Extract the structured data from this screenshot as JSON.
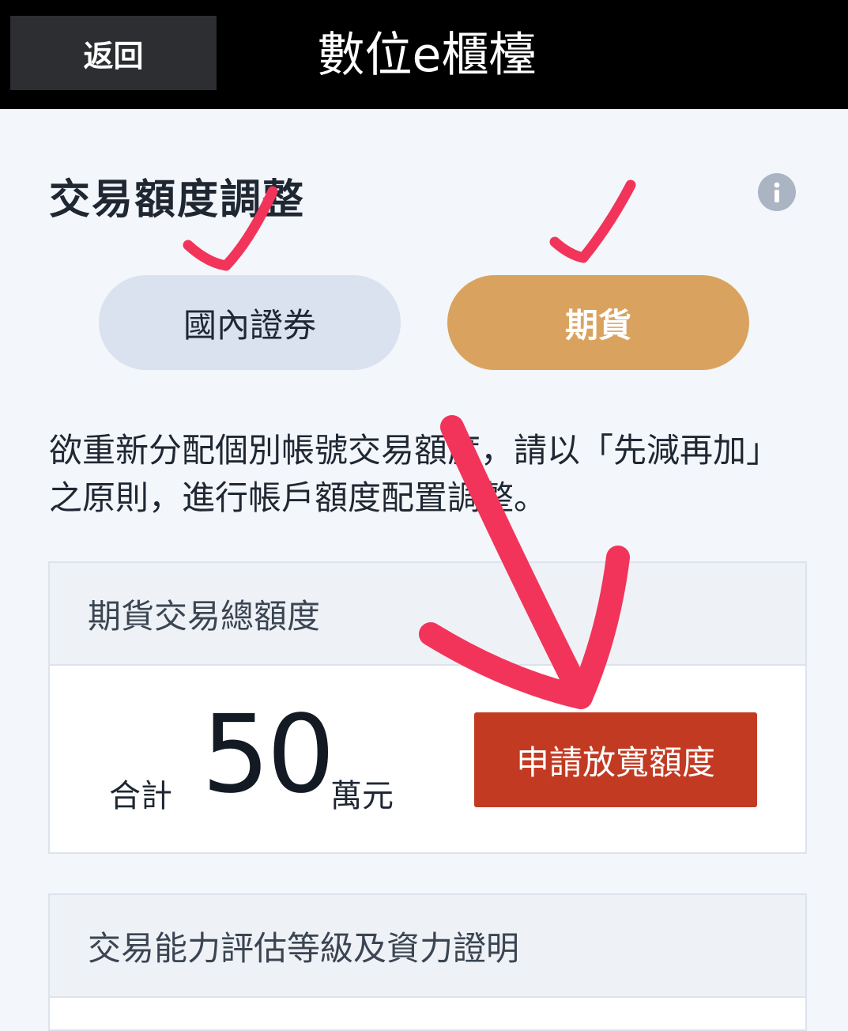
{
  "header": {
    "back_label": "返回",
    "title": "數位e櫃檯"
  },
  "page": {
    "title": "交易額度調整",
    "info_icon": "info-icon"
  },
  "tabs": [
    {
      "label": "國內證券",
      "active": false
    },
    {
      "label": "期貨",
      "active": true
    }
  ],
  "description": "欲重新分配個別帳號交易額度，請以「先減再加」之原則，進行帳戶額度配置調整。",
  "quota_card": {
    "header": "期貨交易總額度",
    "total_label": "合計",
    "total_value": "50",
    "total_unit": "萬元",
    "apply_label": "申請放寬額度"
  },
  "assessment_card": {
    "header": "交易能力評估等級及資力證明"
  },
  "colors": {
    "topbar": "#000000",
    "active_tab": "#d9a35f",
    "inactive_tab": "#d9e2ee",
    "apply_button": "#c23a22",
    "annotation": "#f2345a"
  }
}
